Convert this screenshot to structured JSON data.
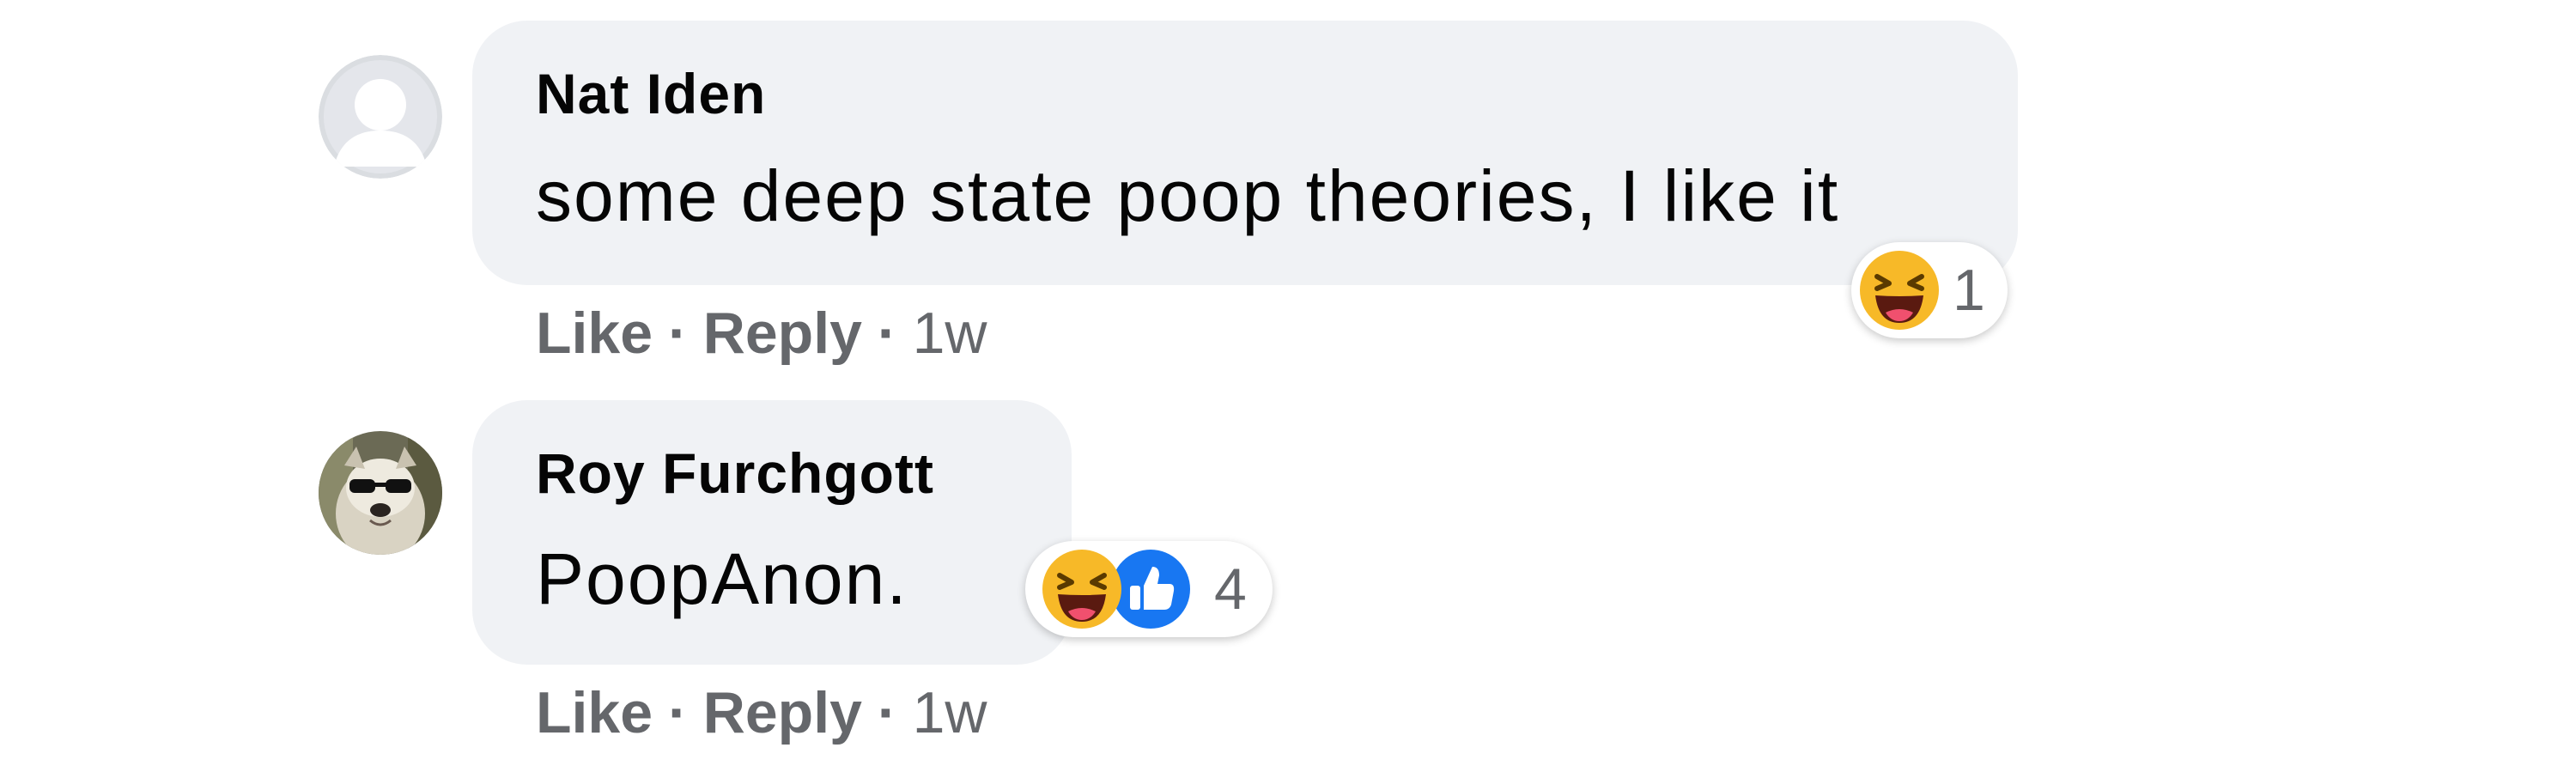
{
  "comments": [
    {
      "author": "Nat Iden",
      "text": "some deep state poop theories, I like it",
      "avatar_icon": "default-user-silhouette-icon",
      "reactions": {
        "icons": [
          "haha-icon"
        ],
        "count": "1"
      },
      "actions": {
        "like": "Like",
        "separator": "·",
        "reply": "Reply",
        "time": "1w"
      }
    },
    {
      "author": "Roy Furchgott",
      "text": "PoopAnon.",
      "avatar_icon": "dog-with-sunglasses-photo",
      "reactions": {
        "icons": [
          "haha-icon",
          "like-thumb-icon"
        ],
        "count": "4"
      },
      "actions": {
        "like": "Like",
        "separator": "·",
        "reply": "Reply",
        "time": "1w"
      }
    }
  ],
  "colors": {
    "bubble": "#f0f2f5",
    "secondary_text": "#65676b",
    "like_blue": "#1877f2",
    "haha_yellow": "#f7b928"
  }
}
